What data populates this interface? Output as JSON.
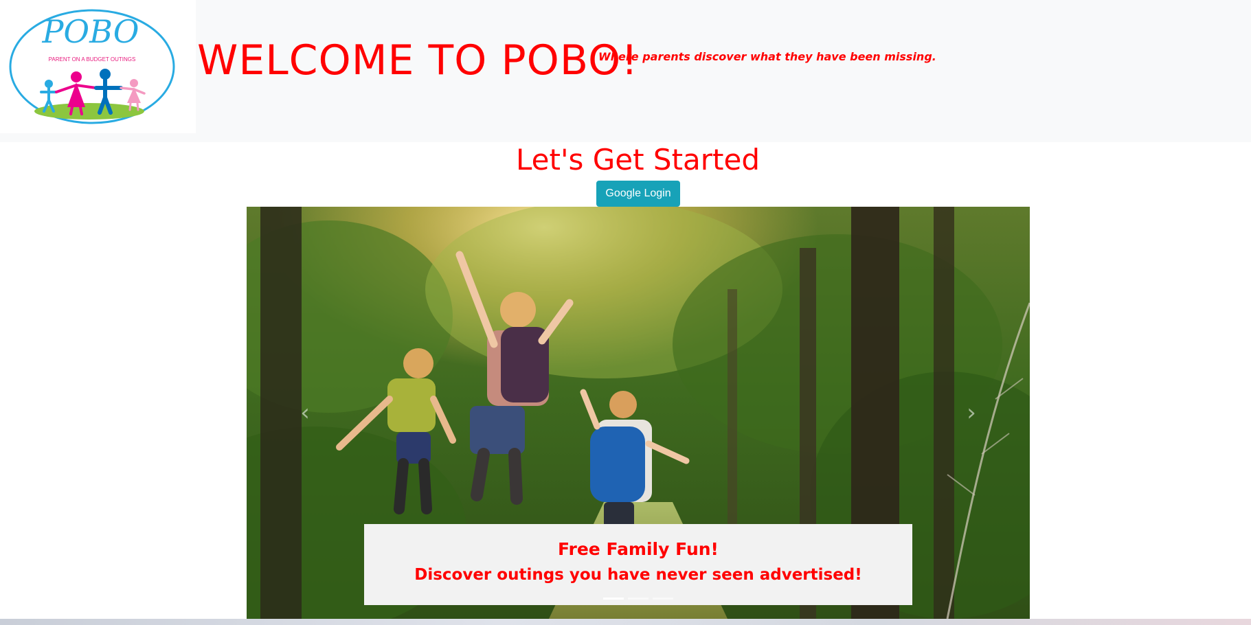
{
  "header": {
    "logo": {
      "brand": "POBO",
      "subtitle": "PARENT ON A BUDGET OUTINGS"
    },
    "welcome_title": "WELCOME TO POBO!",
    "tagline": "Where parents discover what they have been missing."
  },
  "main": {
    "heading": "Let's Get Started",
    "login_button": "Google Login"
  },
  "carousel": {
    "prev_icon": "chevron-left-icon",
    "next_icon": "chevron-right-icon",
    "caption_title": "Free Family Fun!",
    "caption_text": "Discover outings you have never seen advertised!",
    "slide_count": 3,
    "active_slide": 1
  },
  "colors": {
    "accent_red": "#ff0000",
    "button_teal": "#17a2b8",
    "header_bg": "#f8f9fa",
    "logo_blue": "#29abe2"
  }
}
